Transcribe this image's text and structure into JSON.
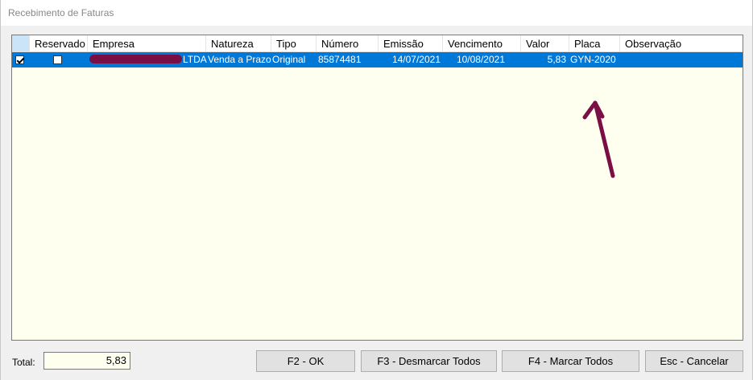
{
  "window": {
    "title": "Recebimento de Faturas"
  },
  "grid": {
    "columns": {
      "reservado": "Reservado",
      "empresa": "Empresa",
      "natureza": "Natureza",
      "tipo": "Tipo",
      "numero": "Número",
      "emissao": "Emissão",
      "vencimento": "Vencimento",
      "valor": "Valor",
      "placa": "Placa",
      "observacao": "Observação"
    },
    "rows": [
      {
        "selected": true,
        "reservado": false,
        "empresa_suffix": "LTDA",
        "natureza": "Venda a Prazo",
        "tipo": "Original",
        "numero": "85874481",
        "emissao": "14/07/2021",
        "vencimento": "10/08/2021",
        "valor": "5,83",
        "placa": "GYN-2020",
        "observacao": ""
      }
    ]
  },
  "footer": {
    "total_label": "Total:",
    "total_value": "5,83",
    "ok_label": "F2 - OK",
    "desmarcar_label": "F3 - Desmarcar Todos",
    "marcar_label": "F4 - Marcar Todos",
    "cancelar_label": "Esc - Cancelar"
  },
  "colors": {
    "selection": "#0078d7",
    "grid_background": "#fffff0",
    "annotation": "#7a0f45"
  }
}
